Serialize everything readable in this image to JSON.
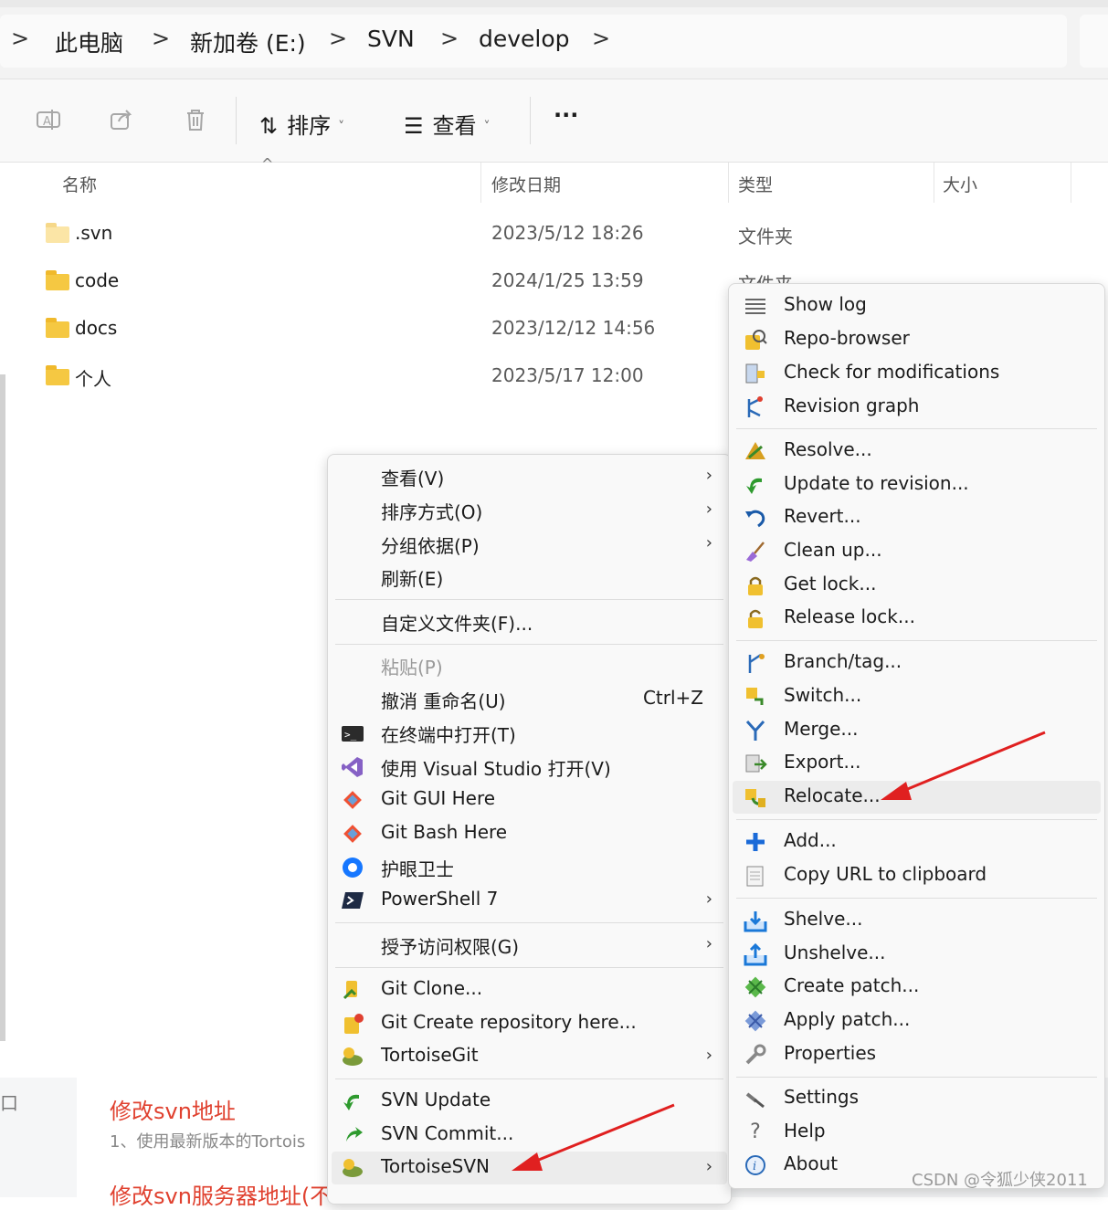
{
  "breadcrumb": {
    "items": [
      "此电脑",
      "新加卷 (E:)",
      "SVN",
      "develop"
    ],
    "separator": ">"
  },
  "toolbar": {
    "sort_label": "排序",
    "view_label": "查看",
    "more_label": "···"
  },
  "columns": {
    "name": "名称",
    "date": "修改日期",
    "type": "类型",
    "size": "大小"
  },
  "files": [
    {
      "name": ".svn",
      "date": "2023/5/12 18:26",
      "type": "文件夹"
    },
    {
      "name": "code",
      "date": "2024/1/25 13:59",
      "type": "文件夹"
    },
    {
      "name": "docs",
      "date": "2023/12/12 14:56",
      "type": ""
    },
    {
      "name": "个人",
      "date": "2023/5/17 12:00",
      "type": ""
    }
  ],
  "context_menu": {
    "view": "查看(V)",
    "sort": "排序方式(O)",
    "group": "分组依据(P)",
    "refresh": "刷新(E)",
    "customize": "自定义文件夹(F)...",
    "paste": "粘贴(P)",
    "undo": "撤消 重命名(U)",
    "undo_shortcut": "Ctrl+Z",
    "terminal": "在终端中打开(T)",
    "vs": "使用 Visual Studio 打开(V)",
    "git_gui": "Git GUI Here",
    "git_bash": "Git Bash Here",
    "eye": "护眼卫士",
    "powershell": "PowerShell 7",
    "access": "授予访问权限(G)",
    "git_clone": "Git Clone...",
    "git_create": "Git Create repository here...",
    "tortoisegit": "TortoiseGit",
    "svn_update": "SVN Update",
    "svn_commit": "SVN Commit...",
    "tortoisesvn": "TortoiseSVN"
  },
  "svn_menu": {
    "show_log": "Show log",
    "repo_browser": "Repo-browser",
    "check_mod": "Check for modifications",
    "rev_graph": "Revision graph",
    "resolve": "Resolve...",
    "update_rev": "Update to revision...",
    "revert": "Revert...",
    "cleanup": "Clean up...",
    "get_lock": "Get lock...",
    "release_lock": "Release lock...",
    "branch": "Branch/tag...",
    "switch": "Switch...",
    "merge": "Merge...",
    "export": "Export...",
    "relocate": "Relocate...",
    "add": "Add...",
    "copy_url": "Copy URL to clipboard",
    "shelve": "Shelve...",
    "unshelve": "Unshelve...",
    "create_patch": "Create patch...",
    "apply_patch": "Apply patch...",
    "properties": "Properties",
    "settings": "Settings",
    "help": "Help",
    "about": "About"
  },
  "blog": {
    "title1": "修改svn地址",
    "line1": "1、使用最新版本的Tortois",
    "title2": "修改svn服务器地址(不",
    "left_char": "口"
  },
  "watermark": "CSDN @令狐少侠2011",
  "colors": {
    "accent_red": "#e0412f",
    "folder": "#f5c842"
  }
}
